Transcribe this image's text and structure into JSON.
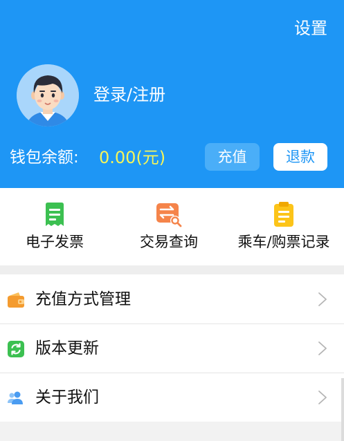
{
  "header": {
    "settings_label": "设置",
    "login_label": "登录/注册",
    "balance_label": "钱包余额:",
    "balance_value": "0.00(元)",
    "recharge_label": "充值",
    "refund_label": "退款",
    "background_color": "#1e96f5",
    "balance_color": "#f5f55a"
  },
  "quick_actions": [
    {
      "label": "电子发票",
      "icon": "receipt-icon",
      "color": "#3cc051"
    },
    {
      "label": "交易查询",
      "icon": "transaction-search-icon",
      "color": "#f5844a"
    },
    {
      "label": "乘车/购票记录",
      "icon": "clipboard-icon",
      "color": "#fcc419"
    }
  ],
  "menu": [
    {
      "label": "充值方式管理",
      "icon": "wallet-icon",
      "color": "#f49b2f"
    },
    {
      "label": "版本更新",
      "icon": "refresh-icon",
      "color": "#3cc051"
    },
    {
      "label": "关于我们",
      "icon": "users-icon",
      "color": "#4a9cf1"
    }
  ]
}
